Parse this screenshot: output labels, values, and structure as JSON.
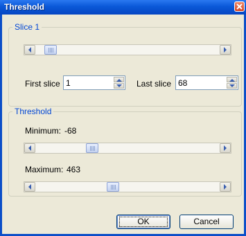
{
  "window": {
    "title": "Threshold"
  },
  "slice_group": {
    "label": "Slice 1",
    "scroll_fraction": 0.05,
    "first_slice": {
      "label": "First slice",
      "value": "1"
    },
    "last_slice": {
      "label": "Last slice",
      "value": "68"
    }
  },
  "threshold_group": {
    "label": "Threshold",
    "minimum": {
      "label": "Minimum:",
      "value": "-68",
      "scroll_fraction": 0.29
    },
    "maximum": {
      "label": "Maximum:",
      "value": "463",
      "scroll_fraction": 0.41
    }
  },
  "buttons": {
    "ok": "OK",
    "cancel": "Cancel"
  },
  "colors": {
    "title_bar": "#0a58d8",
    "group_label": "#0046d5",
    "dialog_bg": "#ece9d8"
  }
}
